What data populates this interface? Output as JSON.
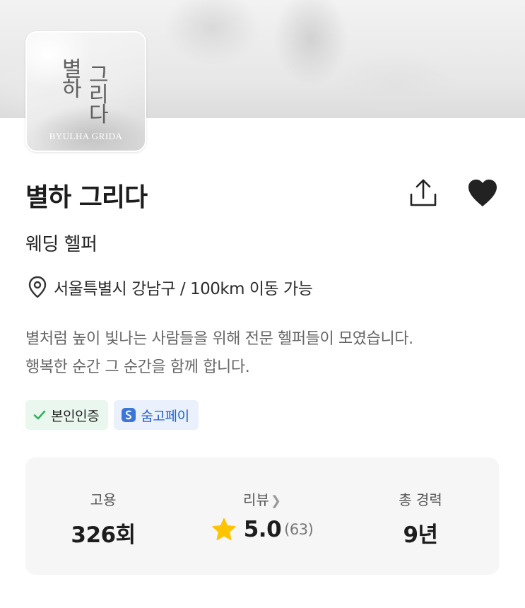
{
  "logo": {
    "chars": [
      "별",
      "하",
      "그",
      "리",
      "다"
    ],
    "subtitle": "BYULHA GRIDA"
  },
  "profile": {
    "name": "별하 그리다",
    "category": "웨딩 헬퍼",
    "location": "서울특별시 강남구 / 100km 이동 가능",
    "description_line1": "별처럼 높이 빛나는 사람들을 위해 전문 헬퍼들이 모였습니다.",
    "description_line2": "행복한 순간 그 순간을 함께 합니다."
  },
  "icons": {
    "share": "share-icon",
    "heart": "heart-icon",
    "location": "location-pin-icon",
    "check": "check-icon",
    "pay": "soomgo-pay-icon",
    "star": "star-icon",
    "chevron": "chevron-right-icon"
  },
  "badges": {
    "verify_label": "본인인증",
    "pay_label": "숨고페이"
  },
  "stats": {
    "hires_label": "고용",
    "hires_value": "326회",
    "review_label": "리뷰",
    "rating_value": "5.0",
    "rating_count": "(63)",
    "career_label": "총 경력",
    "career_value": "9년"
  },
  "colors": {
    "verify_check": "#2fb45f",
    "verify_bg": "#eaf7ee",
    "pay_bg": "#eaf1fc",
    "pay_text": "#1f5fc4",
    "star": "#ffc400",
    "heart": "#222222"
  }
}
